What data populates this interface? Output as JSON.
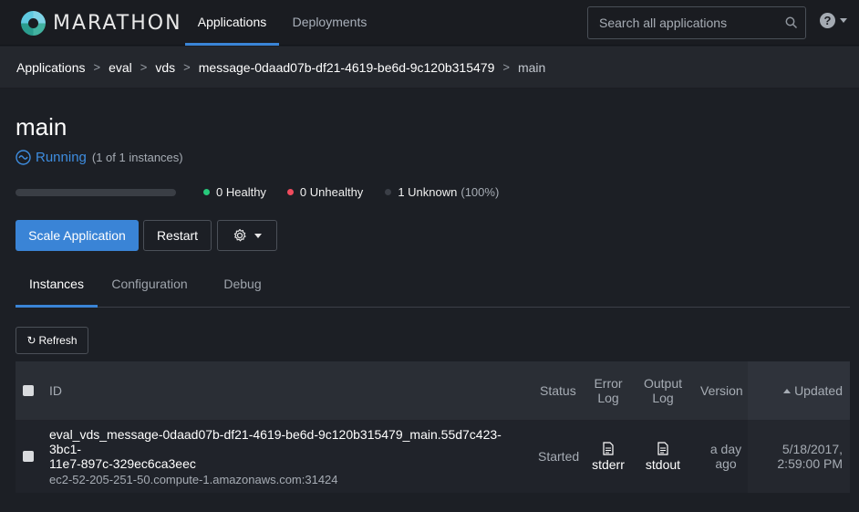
{
  "app": {
    "logo_text": "MARATHON"
  },
  "nav": {
    "tabs": [
      {
        "label": "Applications"
      },
      {
        "label": "Deployments"
      }
    ]
  },
  "search": {
    "placeholder": "Search all applications"
  },
  "help": {
    "glyph": "?"
  },
  "breadcrumb": {
    "items": [
      "Applications",
      "eval",
      "vds",
      "message-0daad07b-df21-4619-be6d-9c120b315479",
      "main"
    ],
    "separator": ">"
  },
  "app_detail": {
    "title": "main",
    "status": "Running",
    "instances_text": "(1 of 1 instances)",
    "health": [
      {
        "label": "0 Healthy",
        "color": "#27c97b"
      },
      {
        "label": "0 Unhealthy",
        "color": "#ef4b5d"
      },
      {
        "label": "1 Unknown",
        "pct": "(100%)",
        "color": "#3b3f47"
      }
    ]
  },
  "actions": {
    "scale_label": "Scale Application",
    "restart_label": "Restart"
  },
  "tabs": [
    {
      "label": "Instances"
    },
    {
      "label": "Configuration"
    },
    {
      "label": "Debug"
    }
  ],
  "refresh": {
    "glyph": "↻",
    "label": "Refresh"
  },
  "table": {
    "headers": {
      "id": "ID",
      "status": "Status",
      "error_log": [
        "Error",
        "Log"
      ],
      "output_log": [
        "Output",
        "Log"
      ],
      "version": "Version",
      "updated": "Updated"
    },
    "rows": [
      {
        "id_line1": "eval_vds_message-0daad07b-df21-4619-be6d-9c120b315479_main.55d7c423-3bc1-",
        "id_line2": "11e7-897c-329ec6ca3eec",
        "host": "ec2-52-205-251-50.compute-1.amazonaws.com:31424",
        "status": "Started",
        "error_log": "stderr",
        "output_log": "stdout",
        "version": [
          "a day",
          "ago"
        ],
        "updated": [
          "5/18/2017,",
          "2:59:00 PM"
        ]
      }
    ]
  },
  "colors": {
    "accent": "#3a84d6",
    "running": "#3e8de0"
  }
}
